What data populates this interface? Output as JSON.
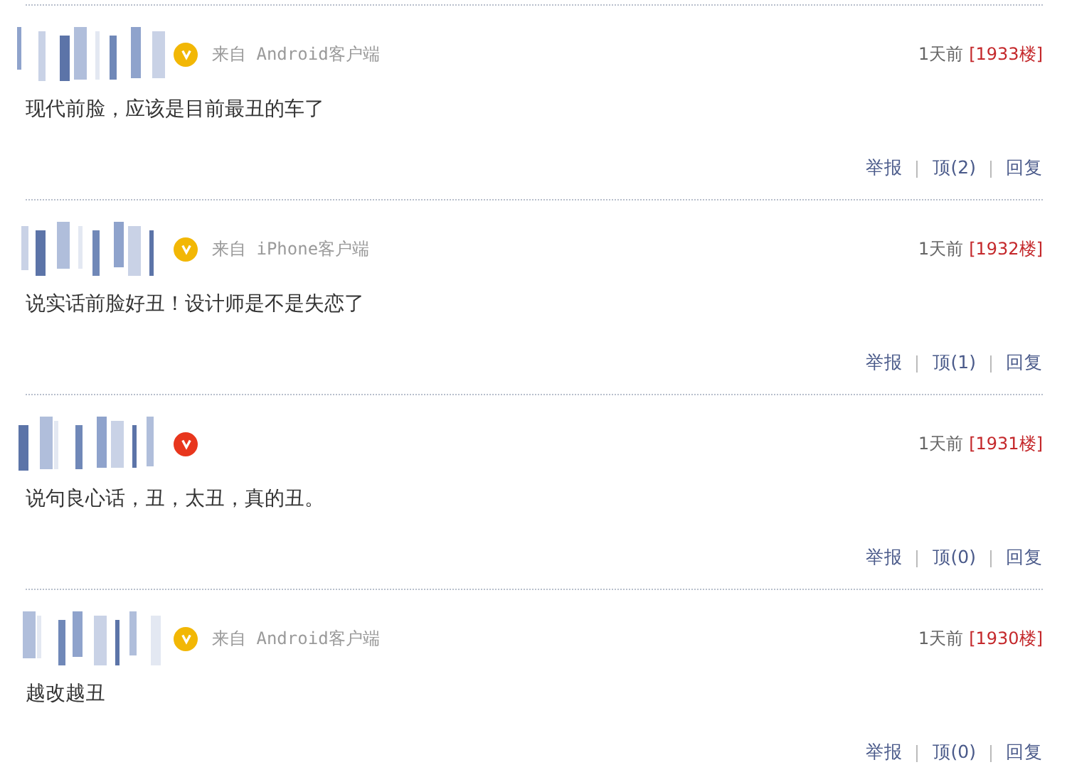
{
  "comments": [
    {
      "badge": {
        "color": "#f2b705"
      },
      "source": "来自 Android客户端",
      "time": "1天前",
      "floor": "[1933楼]",
      "text": "现代前脸，应该是目前最丑的车了",
      "actions": [
        "举报",
        "顶(2)",
        "回复"
      ]
    },
    {
      "badge": {
        "color": "#f2b705"
      },
      "source": "来自 iPhone客户端",
      "time": "1天前",
      "floor": "[1932楼]",
      "text": "说实话前脸好丑！设计师是不是失恋了",
      "actions": [
        "举报",
        "顶(1)",
        "回复"
      ]
    },
    {
      "badge": {
        "color": "#e8361d"
      },
      "time": "1天前",
      "floor": "[1931楼]",
      "text": "说句良心话，丑，太丑，真的丑。",
      "actions": [
        "举报",
        "顶(0)",
        "回复"
      ]
    },
    {
      "badge": {
        "color": "#f2b705"
      },
      "source": "来自 Android客户端",
      "time": "1天前",
      "floor": "[1930楼]",
      "text": "越改越丑",
      "actions": [
        "举报",
        "顶(0)",
        "回复"
      ]
    }
  ]
}
